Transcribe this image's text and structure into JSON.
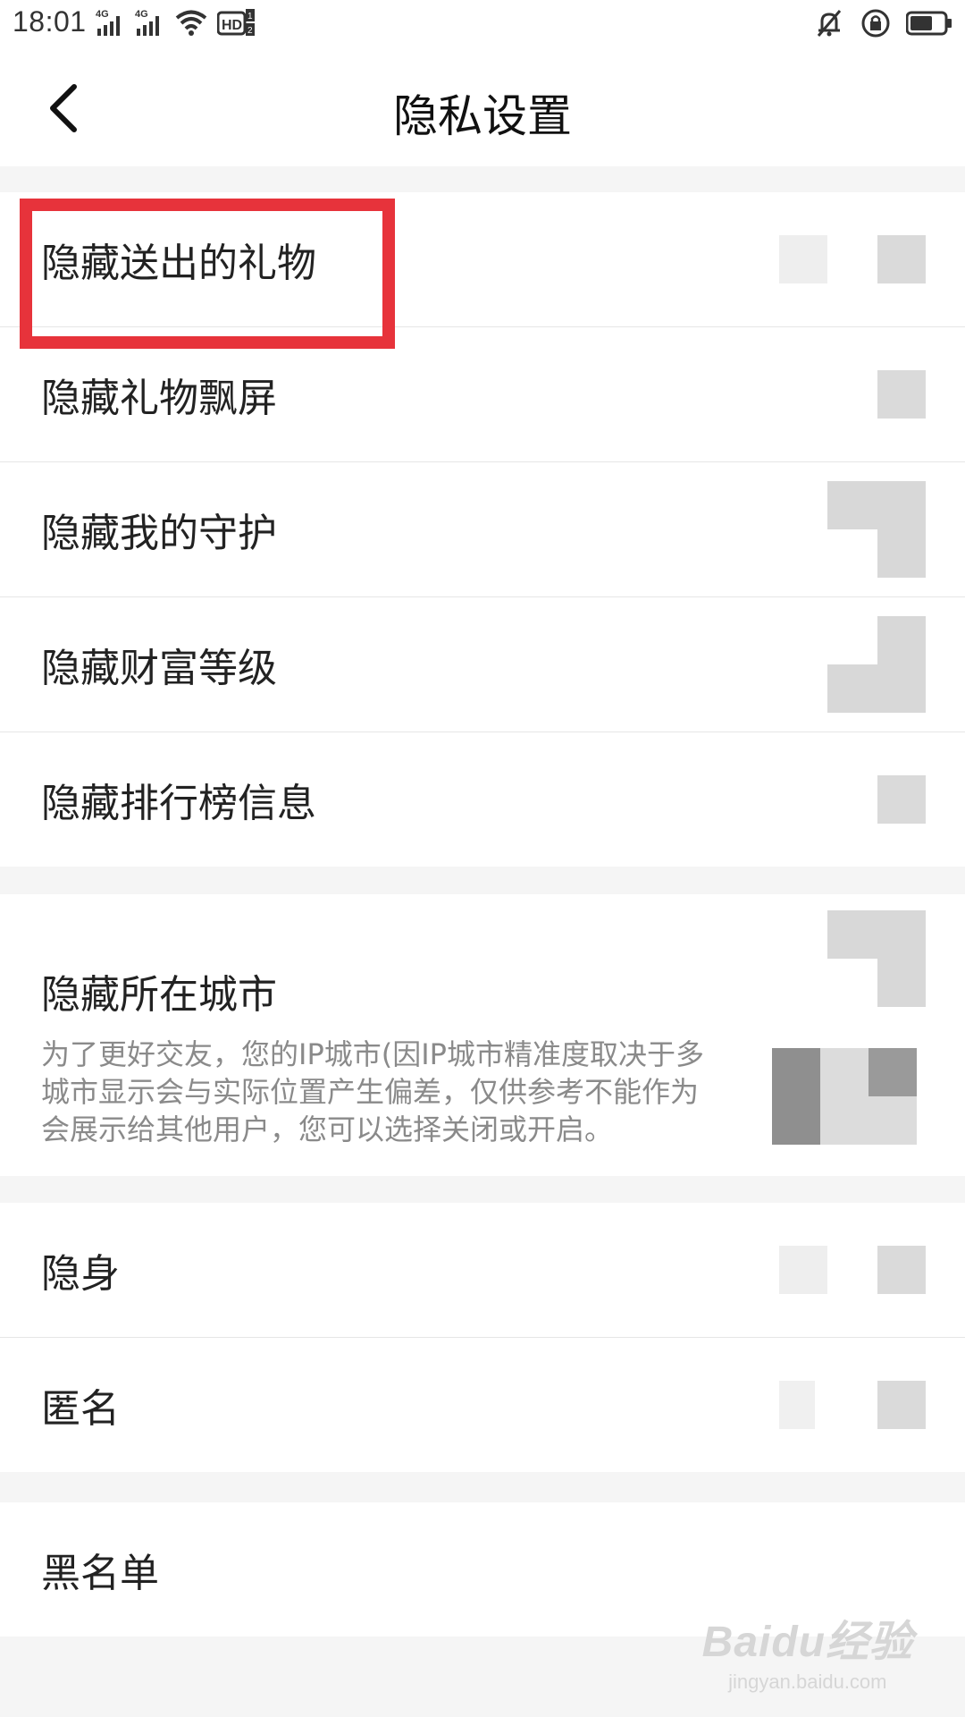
{
  "status_bar": {
    "time": "18:01",
    "network_1": "4G",
    "network_2": "4G",
    "hd_label": "HD",
    "hd_sup": "1",
    "hd_sub": "2"
  },
  "header": {
    "title": "隐私设置",
    "back_icon": "chevron-left-icon"
  },
  "sections": [
    {
      "rows": [
        {
          "label": "隐藏送出的礼物",
          "state": "off"
        },
        {
          "label": "隐藏礼物飘屏",
          "state": "off"
        },
        {
          "label": "隐藏我的守护",
          "state": "on"
        },
        {
          "label": "隐藏财富等级",
          "state": "on"
        },
        {
          "label": "隐藏排行榜信息",
          "state": "off"
        }
      ]
    },
    {
      "rows": [
        {
          "label": "隐藏所在城市",
          "state": "on",
          "description": "为了更好交友，您的IP城市(因IP城市精准度取决于多\n城市显示会与实际位置产生偏差，仅供参考不能作为\n会展示给其他用户，您可以选择关闭或开启。"
        }
      ]
    },
    {
      "rows": [
        {
          "label": "隐身",
          "state": "off"
        },
        {
          "label": "匿名",
          "state": "off"
        }
      ]
    },
    {
      "rows": [
        {
          "label": "黑名单"
        }
      ]
    }
  ],
  "watermark": {
    "main": "Baidu经验",
    "sub": "jingyan.baidu.com"
  },
  "colors": {
    "highlight": "#e7333b",
    "background": "#f5f5f5",
    "row_background": "#ffffff",
    "description_text": "#8a8a8a"
  }
}
